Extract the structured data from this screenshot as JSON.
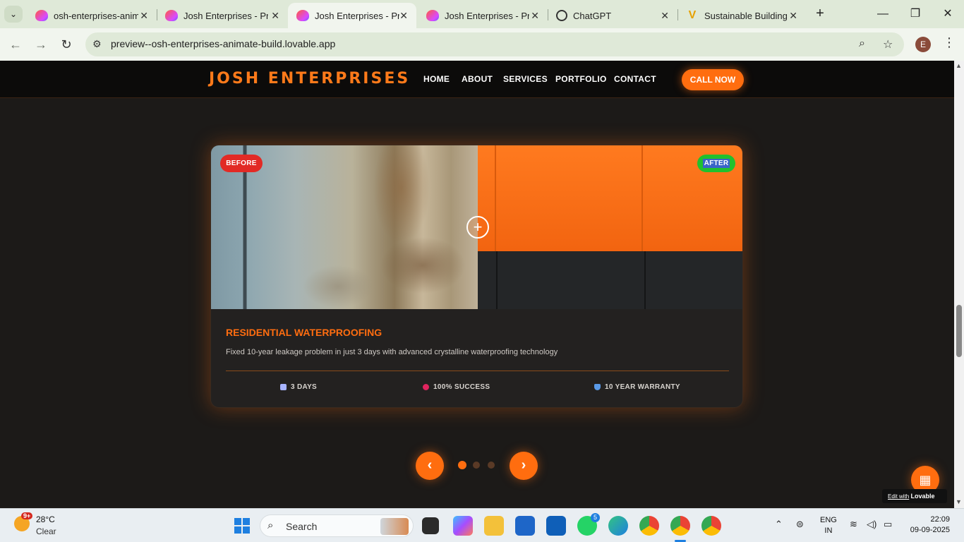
{
  "browser": {
    "tabs": [
      {
        "title": "osh-enterprises-anim",
        "icon": "lovable-icon"
      },
      {
        "title": "Josh Enterprises - Pro",
        "icon": "lovable-icon"
      },
      {
        "title": "Josh Enterprises - Pro",
        "icon": "lovable-icon",
        "active": true
      },
      {
        "title": "Josh Enterprises - Pro",
        "icon": "lovable-icon"
      },
      {
        "title": "ChatGPT",
        "icon": "chatgpt-icon"
      },
      {
        "title": "Sustainable Building S",
        "icon": "v-icon"
      }
    ],
    "url": "preview--osh-enterprises-animate-build.lovable.app",
    "profile_initial": "E"
  },
  "site": {
    "logo": "JOSH ENTERPRISES",
    "nav": [
      "HOME",
      "ABOUT",
      "SERVICES",
      "PORTFOLIO",
      "CONTACT"
    ],
    "cta": "CALL NOW",
    "accent": "#ff6d0f"
  },
  "card": {
    "before_label": "BEFORE",
    "after_label": "AFTER",
    "handle_symbol": "+",
    "title": "RESIDENTIAL WATERPROOFING",
    "description": "Fixed 10-year leakage problem in just 3 days with advanced crystalline waterproofing technology",
    "stats": [
      {
        "icon": "calendar-icon",
        "label": "3 DAYS"
      },
      {
        "icon": "target-icon",
        "label": "100% SUCCESS"
      },
      {
        "icon": "shield-icon",
        "label": "10 YEAR WARRANTY"
      }
    ]
  },
  "carousel": {
    "prev": "‹",
    "next": "›",
    "slide_count": 3,
    "active_index": 0
  },
  "lovable_badge": {
    "prefix": "Edit with",
    "brand": "Lovable"
  },
  "taskbar": {
    "weather_temp": "28°C",
    "weather_condition": "Clear",
    "weather_badge": "9+",
    "search_placeholder": "Search",
    "whatsapp_badge": "5",
    "lang_top": "ENG",
    "lang_bottom": "IN",
    "time": "22:09",
    "date": "09-09-2025"
  }
}
